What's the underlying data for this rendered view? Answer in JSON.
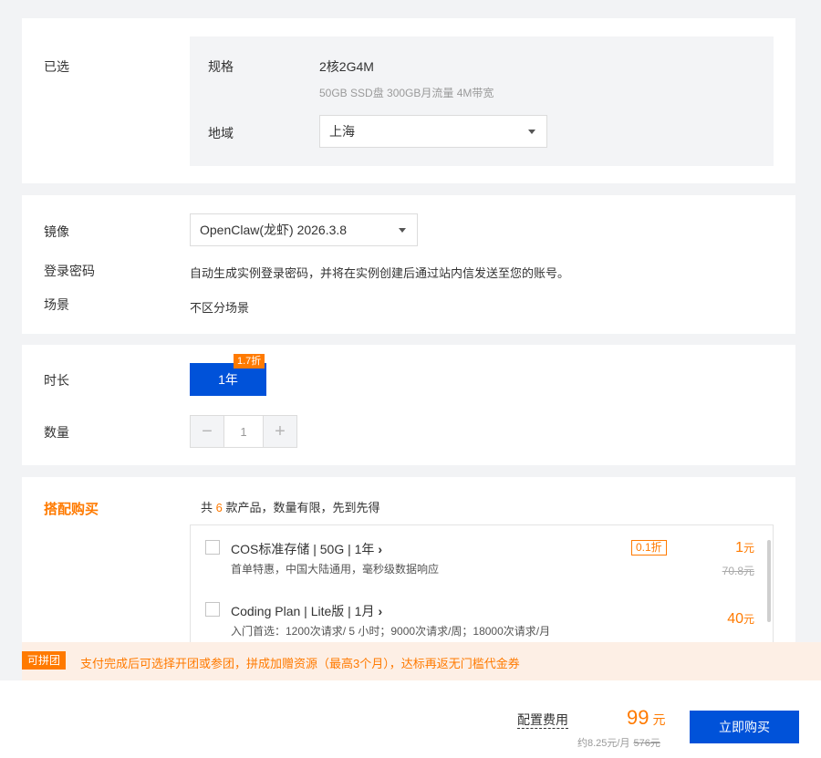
{
  "selected": {
    "label": "已选",
    "spec_label": "规格",
    "spec_value": "2核2G4M",
    "spec_detail": "50GB SSD盘 300GB月流量 4M带宽",
    "region_label": "地域",
    "region_value": "上海"
  },
  "config": {
    "image_label": "镜像",
    "image_value": "OpenClaw(龙虾) 2026.3.8",
    "password_label": "登录密码",
    "password_text": "自动生成实例登录密码，并将在实例创建后通过站内信发送至您的账号。",
    "scene_label": "场景",
    "scene_value": "不区分场景"
  },
  "purchase": {
    "duration_label": "时长",
    "duration_option": "1年",
    "duration_discount": "1.7折",
    "quantity_label": "数量",
    "quantity_minus": "−",
    "quantity_value": "1",
    "quantity_plus": "+"
  },
  "bundle": {
    "title": "搭配购买",
    "count_prefix": "共",
    "count": "6",
    "count_suffix": "款产品，数量有限，先到先得",
    "items": [
      {
        "name": "COS标准存储 | 50G | 1年",
        "desc": "首单特惠，中国大陆通用，毫秒级数据响应",
        "tag": "0.1折",
        "price": "1",
        "unit": "元",
        "original": "70.8元"
      },
      {
        "name": "Coding Plan | Lite版 | 1月",
        "desc": "入门首选：1200次请求/ 5 小时；9000次请求/周；18000次请求/月",
        "price": "40",
        "unit": "元"
      }
    ]
  },
  "banner": {
    "tag": "可拼团",
    "text": "支付完成后可选择开团或参团，拼成加赠资源（最高3个月），达标再返无门槛代金券"
  },
  "footer": {
    "fee_label": "配置费用",
    "price": "99",
    "price_unit": "元",
    "monthly": "约8.25元/月",
    "original": "576元",
    "buy_button": "立即购买"
  },
  "colors": {
    "primary": "#0052d9",
    "accent": "#ff7a00",
    "banner_bg": "#fdefe5"
  }
}
